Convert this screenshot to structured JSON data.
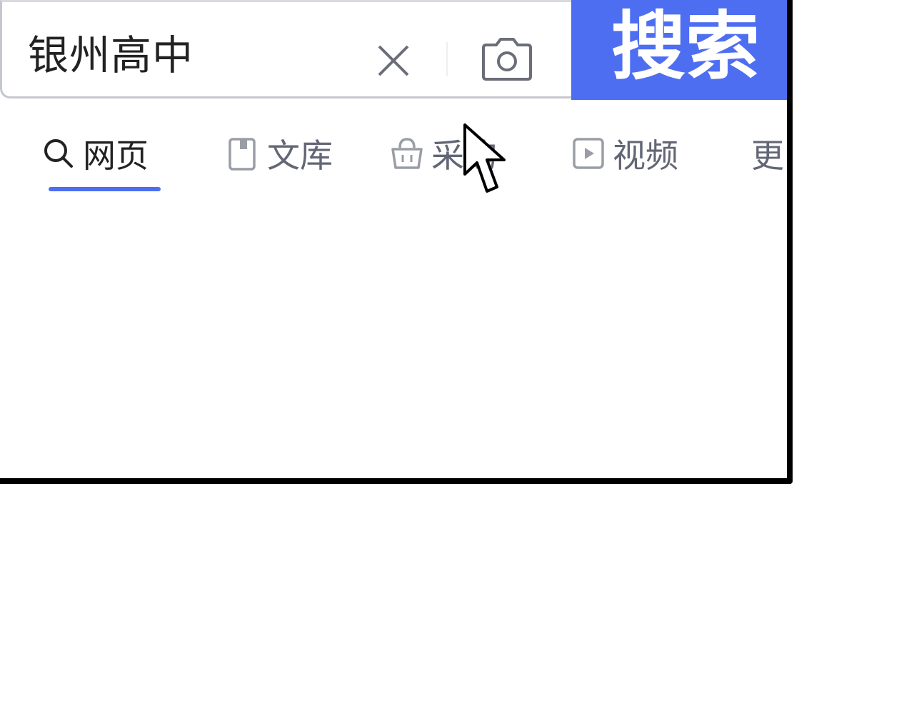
{
  "search": {
    "query": "银州高中",
    "button_label": "搜索"
  },
  "tabs": [
    {
      "label": "网页",
      "icon": "search-icon",
      "active": true
    },
    {
      "label": "文库",
      "icon": "document-icon",
      "active": false
    },
    {
      "label": "采购",
      "icon": "shopping-bag-icon",
      "active": false
    },
    {
      "label": "视频",
      "icon": "video-icon",
      "active": false
    },
    {
      "label": "更",
      "icon": "",
      "active": false
    }
  ],
  "colors": {
    "accent": "#4e6ef2",
    "tab_text": "#626675",
    "frame": "#000000"
  }
}
